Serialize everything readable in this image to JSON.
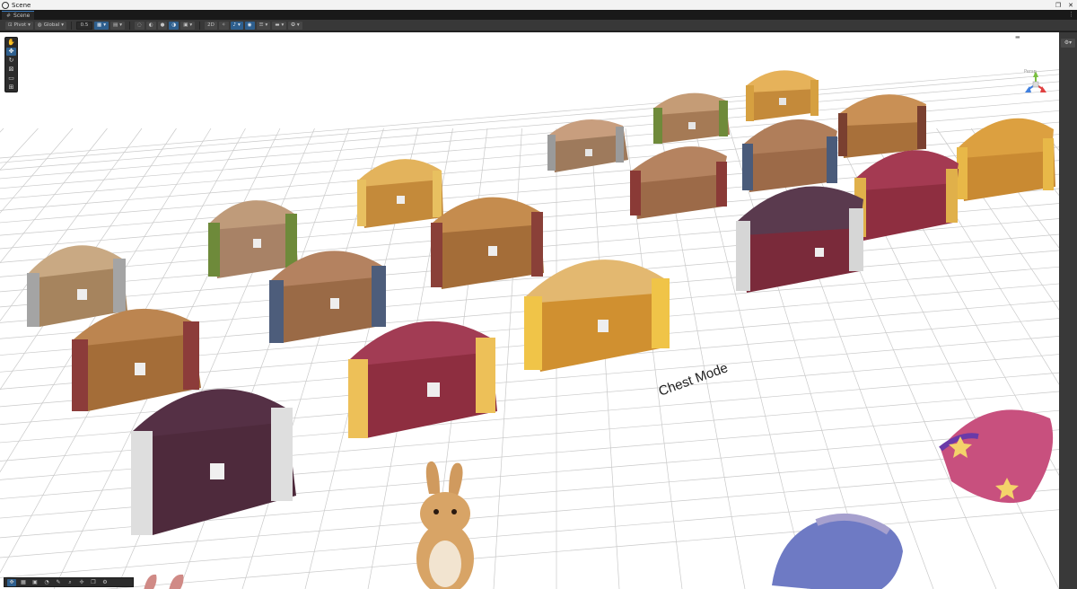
{
  "window": {
    "title": "Scene",
    "restore_glyph": "❐",
    "close_glyph": "✕"
  },
  "tab": {
    "label": "Scene",
    "more_glyph": "⋮"
  },
  "toolbar": {
    "pivot_label": "Pivot",
    "global_label": "Global",
    "snap_value": "0.5",
    "mode_2d_label": "2D"
  },
  "tools": [
    "view-tool",
    "move-tool",
    "rotate-tool",
    "scale-tool",
    "rect-tool",
    "transform-tool"
  ],
  "scene": {
    "world_label": "Chest Mode",
    "gizmo_label": "Persp"
  },
  "colors": {
    "accent": "#2e5f8e",
    "scene_bg": "#ffffff",
    "grid": "#c9c9c9"
  }
}
